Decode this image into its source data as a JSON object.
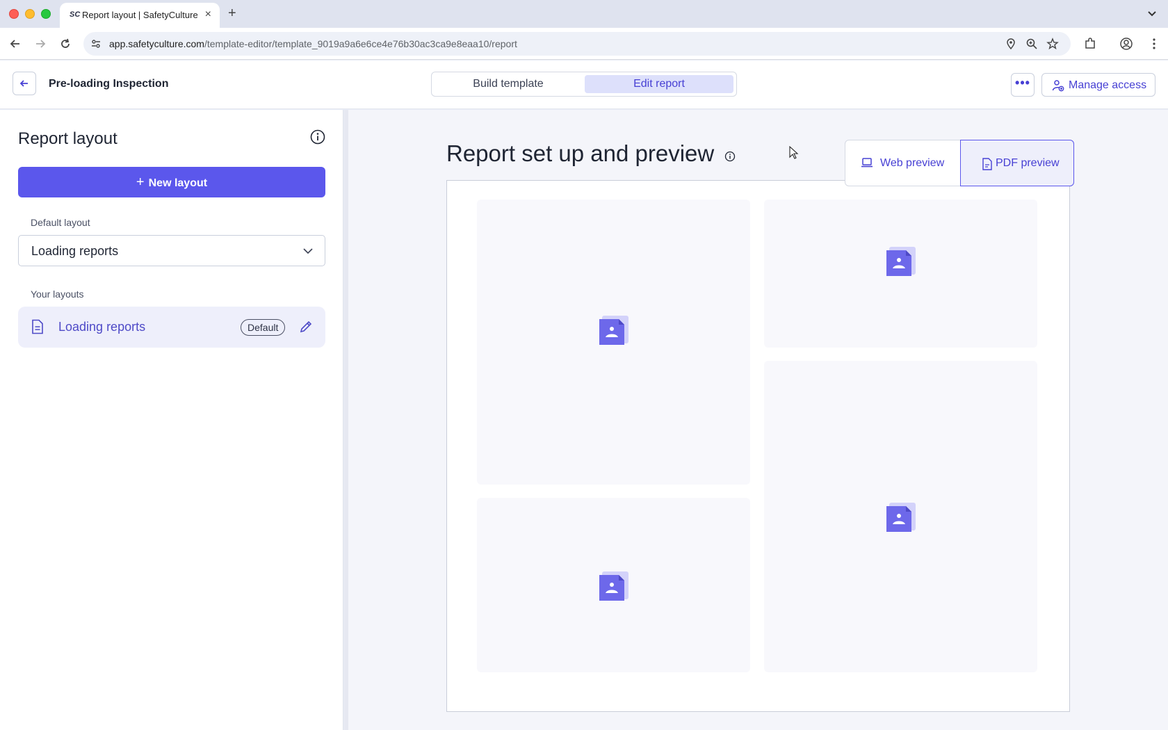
{
  "browser": {
    "tab_title": "Report layout | SafetyCulture",
    "favicon_text": "SC",
    "url_host": "app.safetyculture.com",
    "url_path": "/template-editor/template_9019a9a6e6ce4e76b30ac3ca9e8eaa10/report"
  },
  "header": {
    "inspection_title": "Pre-loading Inspection",
    "tabs": [
      {
        "label": "Build template",
        "active": false
      },
      {
        "label": "Edit report",
        "active": true
      }
    ],
    "more_label": "•••",
    "manage_access_label": "Manage access"
  },
  "sidebar": {
    "title": "Report layout",
    "new_layout_label": "New layout",
    "default_layout_heading": "Default layout",
    "default_layout_value": "Loading reports",
    "your_layouts_heading": "Your layouts",
    "layouts": [
      {
        "label": "Loading reports",
        "badge": "Default"
      }
    ]
  },
  "main": {
    "title": "Report set up and preview",
    "preview_modes": [
      {
        "label": "Web preview",
        "icon": "laptop-icon",
        "active": false
      },
      {
        "label": "PDF preview",
        "icon": "pdf-file-icon",
        "active": true
      }
    ]
  },
  "colors": {
    "accent": "#5b57ec",
    "accent_text": "#4740d4",
    "active_tab_bg": "#dde0fb",
    "placeholder_bg": "#f8f8fc"
  }
}
